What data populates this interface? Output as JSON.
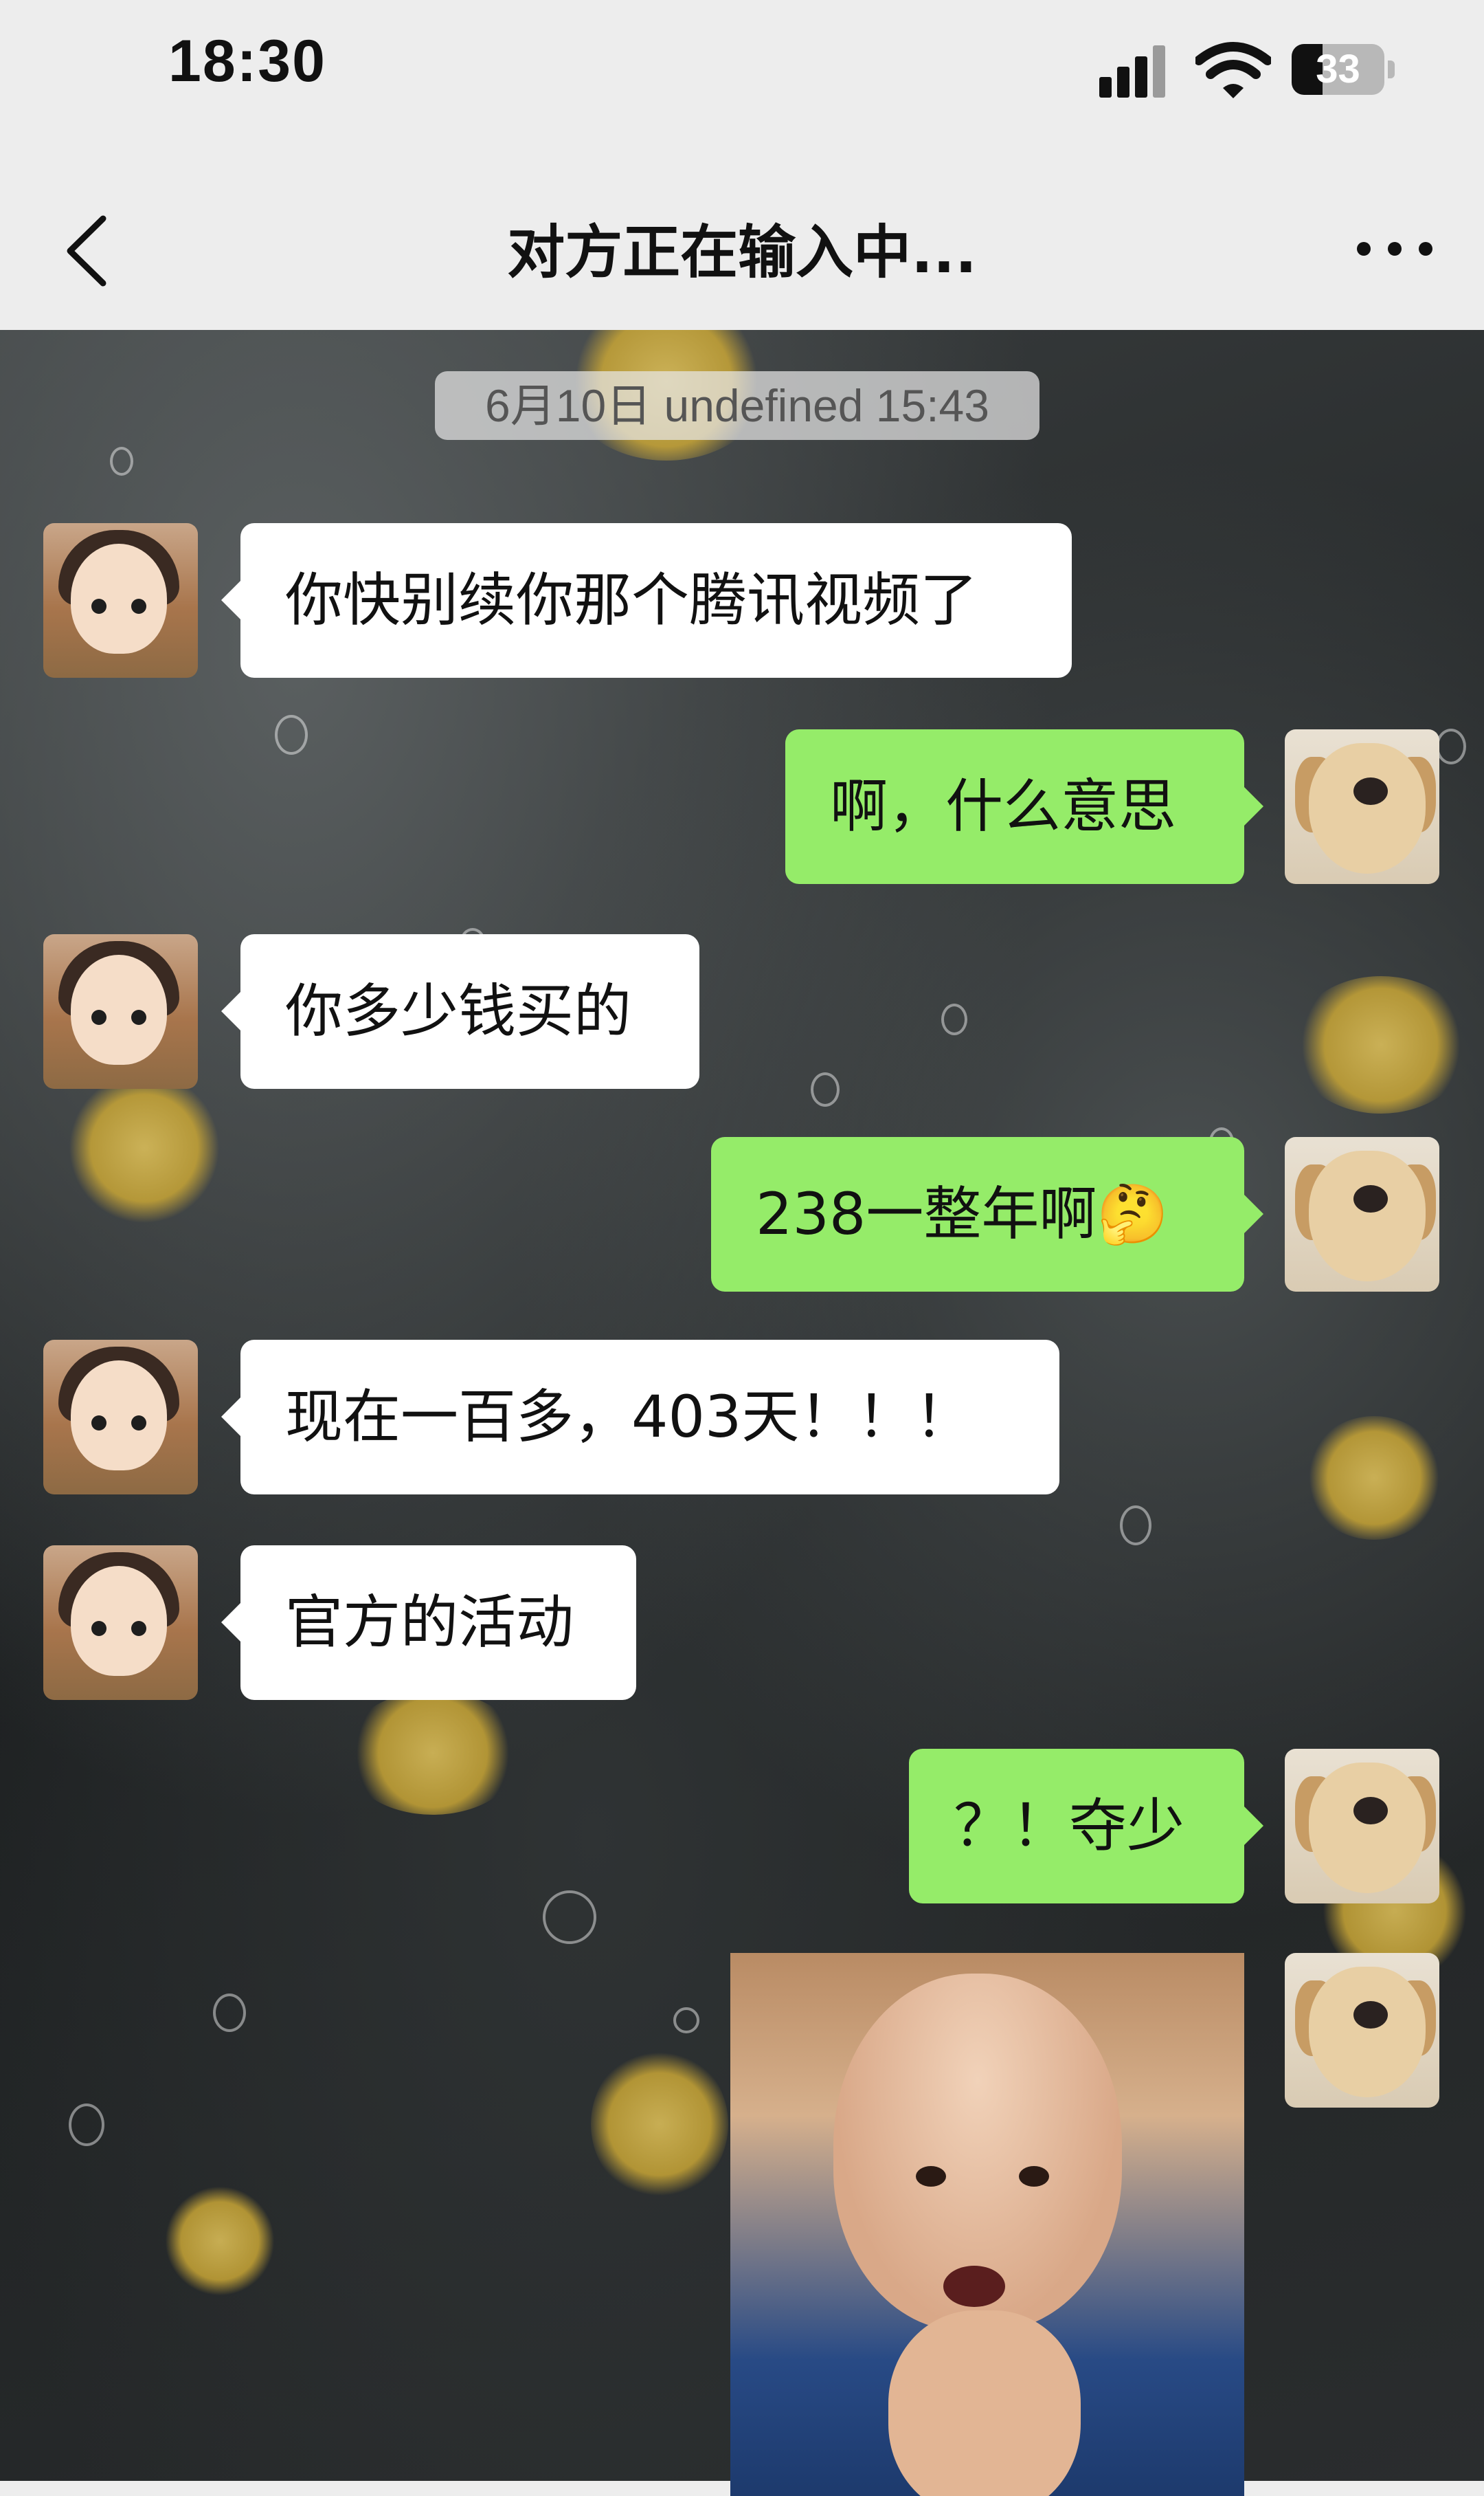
{
  "status_bar": {
    "time": "18:30",
    "battery_level": "33"
  },
  "nav": {
    "title": "对方正在输入中..."
  },
  "chat": {
    "timestamp": "6月10日 undefined 15:43",
    "messages": [
      {
        "side": "left",
        "text": "你快别续你那个腾讯视频了"
      },
      {
        "side": "right",
        "text": "啊，什么意思"
      },
      {
        "side": "left",
        "text": "你多少钱买的"
      },
      {
        "side": "right",
        "text": "238一整年啊🤔"
      },
      {
        "side": "left",
        "text": "现在一百多，403天！！！"
      },
      {
        "side": "left",
        "text": "官方的活动"
      },
      {
        "side": "right",
        "text": "？！夺少"
      },
      {
        "side": "right",
        "type": "sticker"
      }
    ]
  },
  "colors": {
    "self_bubble": "#95ec69",
    "other_bubble": "#ffffff",
    "bar_background": "#ededed"
  }
}
